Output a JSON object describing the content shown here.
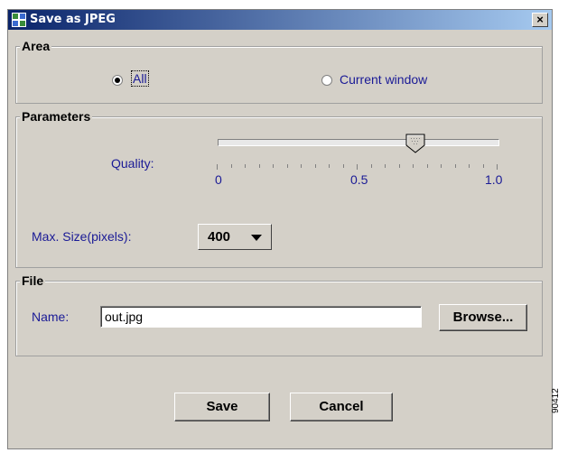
{
  "window": {
    "title": "Save as JPEG",
    "close_label": "×"
  },
  "area": {
    "legend": "Area",
    "options": [
      "All",
      "Current window"
    ],
    "selected": "All"
  },
  "parameters": {
    "legend": "Parameters",
    "quality_label": "Quality:",
    "quality_value": 0.71,
    "quality_ticks": [
      "0",
      "0.5",
      "1.0"
    ],
    "max_size_label": "Max. Size(pixels):",
    "max_size_value": "400"
  },
  "file": {
    "legend": "File",
    "name_label": "Name:",
    "name_value": "out.jpg",
    "browse_label": "Browse..."
  },
  "actions": {
    "save_label": "Save",
    "cancel_label": "Cancel"
  },
  "side_id": "90412"
}
